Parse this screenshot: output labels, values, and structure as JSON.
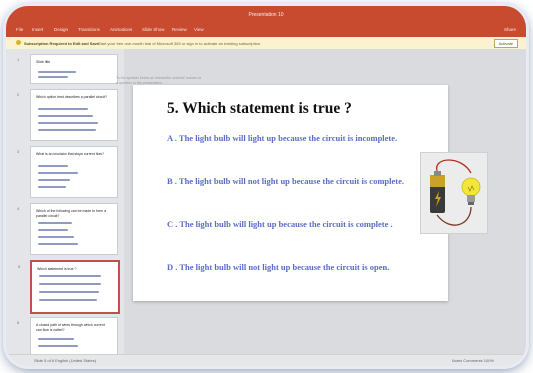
{
  "window": {
    "title": "Presentation 10"
  },
  "menu": {
    "items": [
      "File",
      "Insert",
      "Design",
      "Transitions",
      "Animations",
      "Slide Show",
      "Review",
      "View"
    ],
    "share_label": "Share"
  },
  "notice": {
    "bold": "Subscription Required to Edit and Save",
    "text": "Start your free one-month trial of Microsoft 365 or sign in to activate an existing subscription.",
    "button": "Activate"
  },
  "comment_text": "To the speaker below as 'interactive ordered' answer to a question in the presentation.",
  "thumbnails": [
    {
      "num": "1",
      "q": "Slide title"
    },
    {
      "num": "2",
      "q": "Which option best describes a parallel circuit?"
    },
    {
      "num": "3",
      "q": "What is an insulator that stops current flow?"
    },
    {
      "num": "4",
      "q": "Which of the following can be made to form a parallel circuit?"
    },
    {
      "num": "5",
      "q": "Which statement is true ?"
    },
    {
      "num": "6",
      "q": "A closed path of wires through which current can flow is called?"
    }
  ],
  "slide": {
    "title": "5. Which statement is true ?",
    "options": [
      {
        "letter": "A .",
        "text": " The light bulb will light up because the circuit is incomplete."
      },
      {
        "letter": "B .",
        "text": " The light bulb will not light up because the circuit is complete."
      },
      {
        "letter": "C .",
        "text": " The light bulb will  light up because the circuit is complete ."
      },
      {
        "letter": "D .",
        "text": " The light bulb will not light up because the circuit is open."
      }
    ]
  },
  "status": {
    "left": "Slide 5 of 6   English (United States)",
    "right": "Notes   Comments          100%"
  },
  "colors": {
    "ribbon": "#c84a2f",
    "option_text": "#5b6cc5",
    "selected_thumb": "#c0504d"
  },
  "icons": [
    "warning-icon",
    "battery-icon",
    "light-bulb-icon"
  ]
}
